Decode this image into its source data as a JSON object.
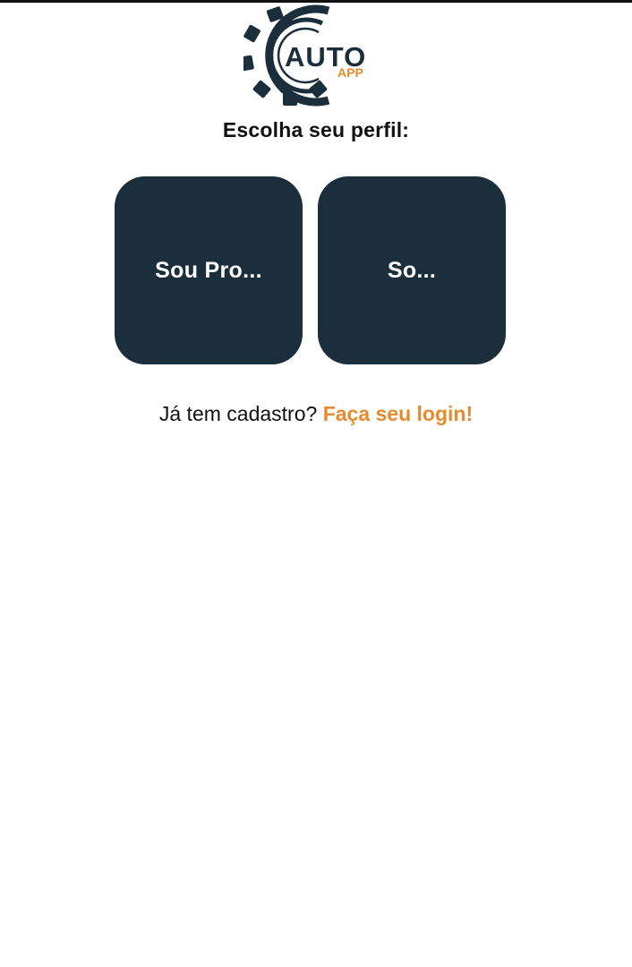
{
  "app": {
    "logo_text": "AUTO",
    "logo_subtext": "APP",
    "colors": {
      "dark": "#1b2e3c",
      "accent": "#e68a2e"
    }
  },
  "profile": {
    "title": "Escolha seu perfil:",
    "options": [
      {
        "label": "Sou Pro..."
      },
      {
        "label": "So..."
      }
    ]
  },
  "login": {
    "prompt": "Já tem cadastro?",
    "link": "Faça seu login!"
  }
}
